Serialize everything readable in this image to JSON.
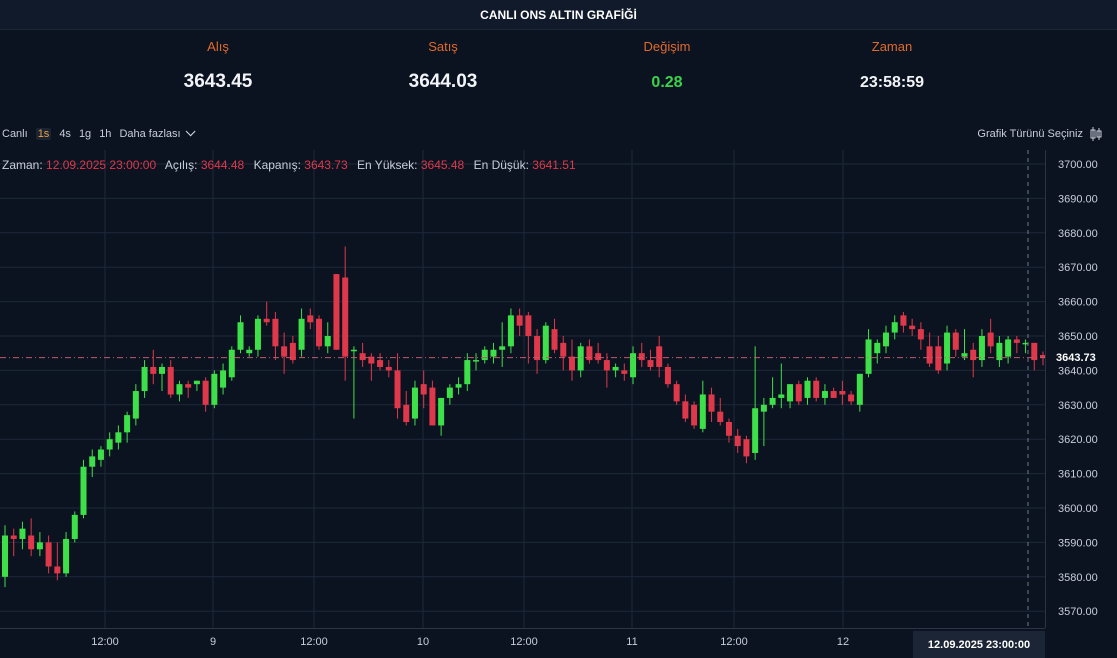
{
  "header": {
    "title": "CANLI ONS ALTIN GRAFİĞİ"
  },
  "stats": {
    "bid_label": "Alış",
    "bid_value": "3643.45",
    "ask_label": "Satış",
    "ask_value": "3644.03",
    "change_label": "Değişim",
    "change_value": "0.28",
    "time_label": "Zaman",
    "time_value": "23:58:59"
  },
  "toolbar": {
    "live_label": "Canlı",
    "intervals": [
      "1s",
      "4s",
      "1g",
      "1h"
    ],
    "active_interval": "1s",
    "more_label": "Daha fazlası",
    "chart_type_label": "Grafik Türünü Seçiniz"
  },
  "ohlc": {
    "time_label": "Zaman:",
    "time_value": "12.09.2025 23:00:00",
    "open_label": "Açılış:",
    "open_value": "3644.48",
    "close_label": "Kapanış:",
    "close_value": "3643.73",
    "high_label": "En Yüksek:",
    "high_value": "3645.48",
    "low_label": "En Düşük:",
    "low_value": "3641.51"
  },
  "price_tag": "3643.73",
  "time_tag": "12.09.2025   23:00:00",
  "colors": {
    "up": "#3ee04a",
    "down": "#e0384b",
    "accent": "#e06a2b",
    "background": "#0b1320"
  },
  "chart_data": {
    "type": "candlestick",
    "ylim": [
      3565,
      3703
    ],
    "y_ticks": [
      "3700.00",
      "3690.00",
      "3680.00",
      "3670.00",
      "3660.00",
      "3650.00",
      "3640.00",
      "3630.00",
      "3620.00",
      "3610.00",
      "3600.00",
      "3590.00",
      "3580.00",
      "3570.00"
    ],
    "x_ticks": [
      "12:00",
      "9",
      "12:00",
      "10",
      "12:00",
      "11",
      "12:00",
      "12"
    ],
    "last_price": 3643.73,
    "candles": [
      {
        "o": 3580,
        "h": 3595,
        "l": 3577,
        "c": 3592
      },
      {
        "o": 3592,
        "h": 3594,
        "l": 3586,
        "c": 3591
      },
      {
        "o": 3591,
        "h": 3596,
        "l": 3588,
        "c": 3594
      },
      {
        "o": 3592,
        "h": 3597,
        "l": 3586,
        "c": 3588
      },
      {
        "o": 3588,
        "h": 3593,
        "l": 3586,
        "c": 3590
      },
      {
        "o": 3590,
        "h": 3592,
        "l": 3581,
        "c": 3583
      },
      {
        "o": 3583,
        "h": 3590,
        "l": 3579,
        "c": 3581
      },
      {
        "o": 3581,
        "h": 3593,
        "l": 3580,
        "c": 3591
      },
      {
        "o": 3591,
        "h": 3599,
        "l": 3590,
        "c": 3598
      },
      {
        "o": 3598,
        "h": 3614,
        "l": 3597,
        "c": 3612
      },
      {
        "o": 3612,
        "h": 3617,
        "l": 3609,
        "c": 3615
      },
      {
        "o": 3614,
        "h": 3618,
        "l": 3612,
        "c": 3617
      },
      {
        "o": 3617,
        "h": 3622,
        "l": 3615,
        "c": 3620
      },
      {
        "o": 3619,
        "h": 3624,
        "l": 3617,
        "c": 3622
      },
      {
        "o": 3622,
        "h": 3628,
        "l": 3619,
        "c": 3627
      },
      {
        "o": 3626,
        "h": 3636,
        "l": 3624,
        "c": 3634
      },
      {
        "o": 3634,
        "h": 3643,
        "l": 3632,
        "c": 3641
      },
      {
        "o": 3641,
        "h": 3646,
        "l": 3636,
        "c": 3639
      },
      {
        "o": 3639,
        "h": 3642,
        "l": 3634,
        "c": 3641
      },
      {
        "o": 3641,
        "h": 3643,
        "l": 3632,
        "c": 3633
      },
      {
        "o": 3633,
        "h": 3637,
        "l": 3631,
        "c": 3636
      },
      {
        "o": 3636,
        "h": 3637,
        "l": 3632,
        "c": 3635
      },
      {
        "o": 3636,
        "h": 3637,
        "l": 3634,
        "c": 3637
      },
      {
        "o": 3637,
        "h": 3638,
        "l": 3628,
        "c": 3630
      },
      {
        "o": 3630,
        "h": 3640,
        "l": 3629,
        "c": 3639
      },
      {
        "o": 3635,
        "h": 3642,
        "l": 3633,
        "c": 3640
      },
      {
        "o": 3638,
        "h": 3647,
        "l": 3637,
        "c": 3646
      },
      {
        "o": 3646,
        "h": 3656,
        "l": 3645,
        "c": 3654
      },
      {
        "o": 3645,
        "h": 3647,
        "l": 3644,
        "c": 3646
      },
      {
        "o": 3646,
        "h": 3656,
        "l": 3644,
        "c": 3655
      },
      {
        "o": 3655,
        "h": 3660,
        "l": 3653,
        "c": 3654
      },
      {
        "o": 3655,
        "h": 3657,
        "l": 3643,
        "c": 3647
      },
      {
        "o": 3647,
        "h": 3651,
        "l": 3639,
        "c": 3644
      },
      {
        "o": 3648,
        "h": 3650,
        "l": 3642,
        "c": 3643
      },
      {
        "o": 3646,
        "h": 3658,
        "l": 3644,
        "c": 3655
      },
      {
        "o": 3656,
        "h": 3658,
        "l": 3652,
        "c": 3654
      },
      {
        "o": 3655,
        "h": 3656,
        "l": 3646,
        "c": 3647
      },
      {
        "o": 3647,
        "h": 3654,
        "l": 3645,
        "c": 3650
      },
      {
        "o": 3668,
        "h": 3668,
        "l": 3646,
        "c": 3646
      },
      {
        "o": 3667,
        "h": 3676,
        "l": 3637,
        "c": 3644
      },
      {
        "o": 3646,
        "h": 3647,
        "l": 3626,
        "c": 3646
      },
      {
        "o": 3645,
        "h": 3648,
        "l": 3641,
        "c": 3643
      },
      {
        "o": 3644,
        "h": 3645,
        "l": 3637,
        "c": 3642
      },
      {
        "o": 3643,
        "h": 3645,
        "l": 3640,
        "c": 3641
      },
      {
        "o": 3641,
        "h": 3643,
        "l": 3638,
        "c": 3640
      },
      {
        "o": 3640,
        "h": 3645,
        "l": 3626,
        "c": 3629
      },
      {
        "o": 3630,
        "h": 3634,
        "l": 3624,
        "c": 3625
      },
      {
        "o": 3626,
        "h": 3637,
        "l": 3624,
        "c": 3635
      },
      {
        "o": 3636,
        "h": 3640,
        "l": 3629,
        "c": 3633
      },
      {
        "o": 3635,
        "h": 3637,
        "l": 3624,
        "c": 3624
      },
      {
        "o": 3624,
        "h": 3632,
        "l": 3621,
        "c": 3632
      },
      {
        "o": 3632,
        "h": 3636,
        "l": 3630,
        "c": 3635
      },
      {
        "o": 3635,
        "h": 3638,
        "l": 3633,
        "c": 3636
      },
      {
        "o": 3636,
        "h": 3645,
        "l": 3634,
        "c": 3643
      },
      {
        "o": 3643,
        "h": 3645,
        "l": 3640,
        "c": 3643
      },
      {
        "o": 3643,
        "h": 3647,
        "l": 3642,
        "c": 3646
      },
      {
        "o": 3644,
        "h": 3648,
        "l": 3642,
        "c": 3646
      },
      {
        "o": 3646,
        "h": 3654,
        "l": 3641,
        "c": 3647
      },
      {
        "o": 3647,
        "h": 3658,
        "l": 3645,
        "c": 3656
      },
      {
        "o": 3656,
        "h": 3658,
        "l": 3650,
        "c": 3653
      },
      {
        "o": 3656,
        "h": 3657,
        "l": 3642,
        "c": 3650
      },
      {
        "o": 3650,
        "h": 3652,
        "l": 3639,
        "c": 3643
      },
      {
        "o": 3643,
        "h": 3654,
        "l": 3642,
        "c": 3653
      },
      {
        "o": 3652,
        "h": 3655,
        "l": 3645,
        "c": 3646
      },
      {
        "o": 3648,
        "h": 3650,
        "l": 3640,
        "c": 3644
      },
      {
        "o": 3644,
        "h": 3649,
        "l": 3637,
        "c": 3640
      },
      {
        "o": 3640,
        "h": 3648,
        "l": 3638,
        "c": 3647
      },
      {
        "o": 3647,
        "h": 3649,
        "l": 3642,
        "c": 3643
      },
      {
        "o": 3645,
        "h": 3648,
        "l": 3642,
        "c": 3643
      },
      {
        "o": 3643,
        "h": 3645,
        "l": 3635,
        "c": 3640
      },
      {
        "o": 3640,
        "h": 3642,
        "l": 3638,
        "c": 3641
      },
      {
        "o": 3640,
        "h": 3642,
        "l": 3637,
        "c": 3639
      },
      {
        "o": 3638,
        "h": 3647,
        "l": 3636,
        "c": 3645
      },
      {
        "o": 3645,
        "h": 3648,
        "l": 3641,
        "c": 3643
      },
      {
        "o": 3643,
        "h": 3646,
        "l": 3640,
        "c": 3641
      },
      {
        "o": 3647,
        "h": 3650,
        "l": 3638,
        "c": 3641
      },
      {
        "o": 3641,
        "h": 3642,
        "l": 3635,
        "c": 3636
      },
      {
        "o": 3636,
        "h": 3637,
        "l": 3630,
        "c": 3631
      },
      {
        "o": 3631,
        "h": 3633,
        "l": 3625,
        "c": 3626
      },
      {
        "o": 3630,
        "h": 3631,
        "l": 3623,
        "c": 3624
      },
      {
        "o": 3623,
        "h": 3637,
        "l": 3622,
        "c": 3633
      },
      {
        "o": 3633,
        "h": 3635,
        "l": 3625,
        "c": 3628
      },
      {
        "o": 3628,
        "h": 3632,
        "l": 3624,
        "c": 3625
      },
      {
        "o": 3625,
        "h": 3626,
        "l": 3619,
        "c": 3621
      },
      {
        "o": 3621,
        "h": 3623,
        "l": 3616,
        "c": 3618
      },
      {
        "o": 3620,
        "h": 3621,
        "l": 3613,
        "c": 3615
      },
      {
        "o": 3616,
        "h": 3647,
        "l": 3614,
        "c": 3629
      },
      {
        "o": 3628,
        "h": 3632,
        "l": 3618,
        "c": 3630
      },
      {
        "o": 3630,
        "h": 3638,
        "l": 3629,
        "c": 3632
      },
      {
        "o": 3632,
        "h": 3642,
        "l": 3629,
        "c": 3633
      },
      {
        "o": 3631,
        "h": 3636,
        "l": 3629,
        "c": 3636
      },
      {
        "o": 3636,
        "h": 3637,
        "l": 3630,
        "c": 3631
      },
      {
        "o": 3632,
        "h": 3638,
        "l": 3630,
        "c": 3637
      },
      {
        "o": 3637,
        "h": 3638,
        "l": 3631,
        "c": 3632
      },
      {
        "o": 3632,
        "h": 3636,
        "l": 3630,
        "c": 3634
      },
      {
        "o": 3634,
        "h": 3635,
        "l": 3632,
        "c": 3632
      },
      {
        "o": 3634,
        "h": 3637,
        "l": 3630,
        "c": 3633
      },
      {
        "o": 3633,
        "h": 3634,
        "l": 3630,
        "c": 3631
      },
      {
        "o": 3630,
        "h": 3639,
        "l": 3628,
        "c": 3639
      },
      {
        "o": 3639,
        "h": 3652,
        "l": 3638,
        "c": 3649
      },
      {
        "o": 3645,
        "h": 3649,
        "l": 3642,
        "c": 3648
      },
      {
        "o": 3647,
        "h": 3653,
        "l": 3645,
        "c": 3651
      },
      {
        "o": 3651,
        "h": 3656,
        "l": 3649,
        "c": 3654
      },
      {
        "o": 3656,
        "h": 3657,
        "l": 3651,
        "c": 3653
      },
      {
        "o": 3653,
        "h": 3655,
        "l": 3650,
        "c": 3652
      },
      {
        "o": 3652,
        "h": 3654,
        "l": 3646,
        "c": 3649
      },
      {
        "o": 3647,
        "h": 3651,
        "l": 3641,
        "c": 3642
      },
      {
        "o": 3647,
        "h": 3650,
        "l": 3639,
        "c": 3640
      },
      {
        "o": 3642,
        "h": 3653,
        "l": 3640,
        "c": 3651
      },
      {
        "o": 3651,
        "h": 3652,
        "l": 3644,
        "c": 3646
      },
      {
        "o": 3644,
        "h": 3652,
        "l": 3643,
        "c": 3645
      },
      {
        "o": 3646,
        "h": 3648,
        "l": 3638,
        "c": 3643
      },
      {
        "o": 3643,
        "h": 3652,
        "l": 3641,
        "c": 3650
      },
      {
        "o": 3651,
        "h": 3655,
        "l": 3645,
        "c": 3647
      },
      {
        "o": 3643,
        "h": 3650,
        "l": 3641,
        "c": 3648
      },
      {
        "o": 3644,
        "h": 3650,
        "l": 3642,
        "c": 3649
      },
      {
        "o": 3649,
        "h": 3650,
        "l": 3645,
        "c": 3648
      },
      {
        "o": 3648,
        "h": 3649,
        "l": 3645,
        "c": 3648
      },
      {
        "o": 3648,
        "h": 3648,
        "l": 3640,
        "c": 3643
      },
      {
        "o": 3644.48,
        "h": 3645.48,
        "l": 3641.51,
        "c": 3643.73
      }
    ]
  }
}
